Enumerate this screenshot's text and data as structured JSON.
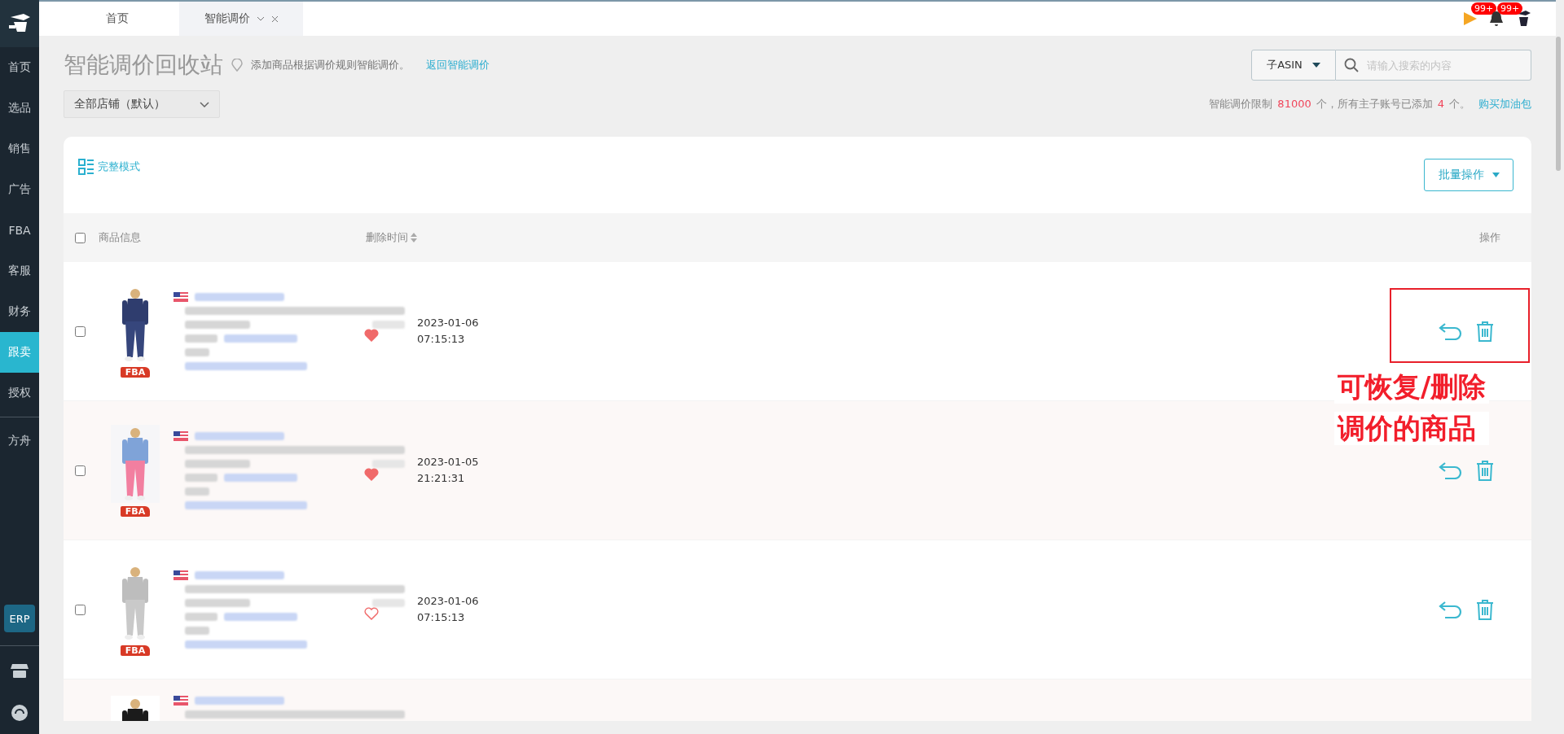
{
  "sidebar": {
    "items": [
      {
        "label": "首页",
        "selected": false
      },
      {
        "label": "选品",
        "selected": false
      },
      {
        "label": "销售",
        "selected": false
      },
      {
        "label": "广告",
        "selected": false
      },
      {
        "label": "FBA",
        "selected": false
      },
      {
        "label": "客服",
        "selected": false
      },
      {
        "label": "财务",
        "selected": false
      },
      {
        "label": "跟卖",
        "selected": true
      },
      {
        "label": "授权",
        "selected": false
      },
      {
        "label": "方舟",
        "selected": false
      }
    ],
    "erp": "ERP"
  },
  "tabs": [
    {
      "label": "首页",
      "selected": false
    },
    {
      "label": "智能调价",
      "selected": true
    }
  ],
  "header": {
    "flag_badge": "99+",
    "bell_badge": "99+"
  },
  "page": {
    "title": "智能调价回收站",
    "hint": "添加商品根据调价规则智能调价。",
    "back_link": "返回智能调价",
    "store_select": "全部店铺（默认）",
    "search_type": "子ASIN",
    "search_placeholder": "请输入搜索的内容",
    "limit": {
      "prefix": "智能调价限制",
      "limit": "81000",
      "middle": "个，所有主子账号已添加",
      "added": "4",
      "suffix": "个。",
      "link": "购买加油包"
    }
  },
  "card": {
    "mode": "完整模式",
    "bulk": "批量操作",
    "select_all_checked": false,
    "columns": {
      "product": "商品信息",
      "deleted_at": "删除时间",
      "actions": "操作"
    },
    "rows": [
      {
        "date": "2023-01-06",
        "time": "07:15:13",
        "favorite": true,
        "checked": false,
        "badge": "FBA",
        "kind": "navy"
      },
      {
        "date": "2023-01-05",
        "time": "21:21:31",
        "favorite": true,
        "checked": false,
        "badge": "FBA",
        "kind": "tiedye"
      },
      {
        "date": "2023-01-06",
        "time": "07:15:13",
        "favorite": false,
        "checked": false,
        "badge": "FBA",
        "kind": "grey"
      },
      {
        "kind": "black"
      }
    ]
  },
  "annotation": {
    "lines": [
      "可恢复/删除",
      "调价的商品"
    ]
  }
}
